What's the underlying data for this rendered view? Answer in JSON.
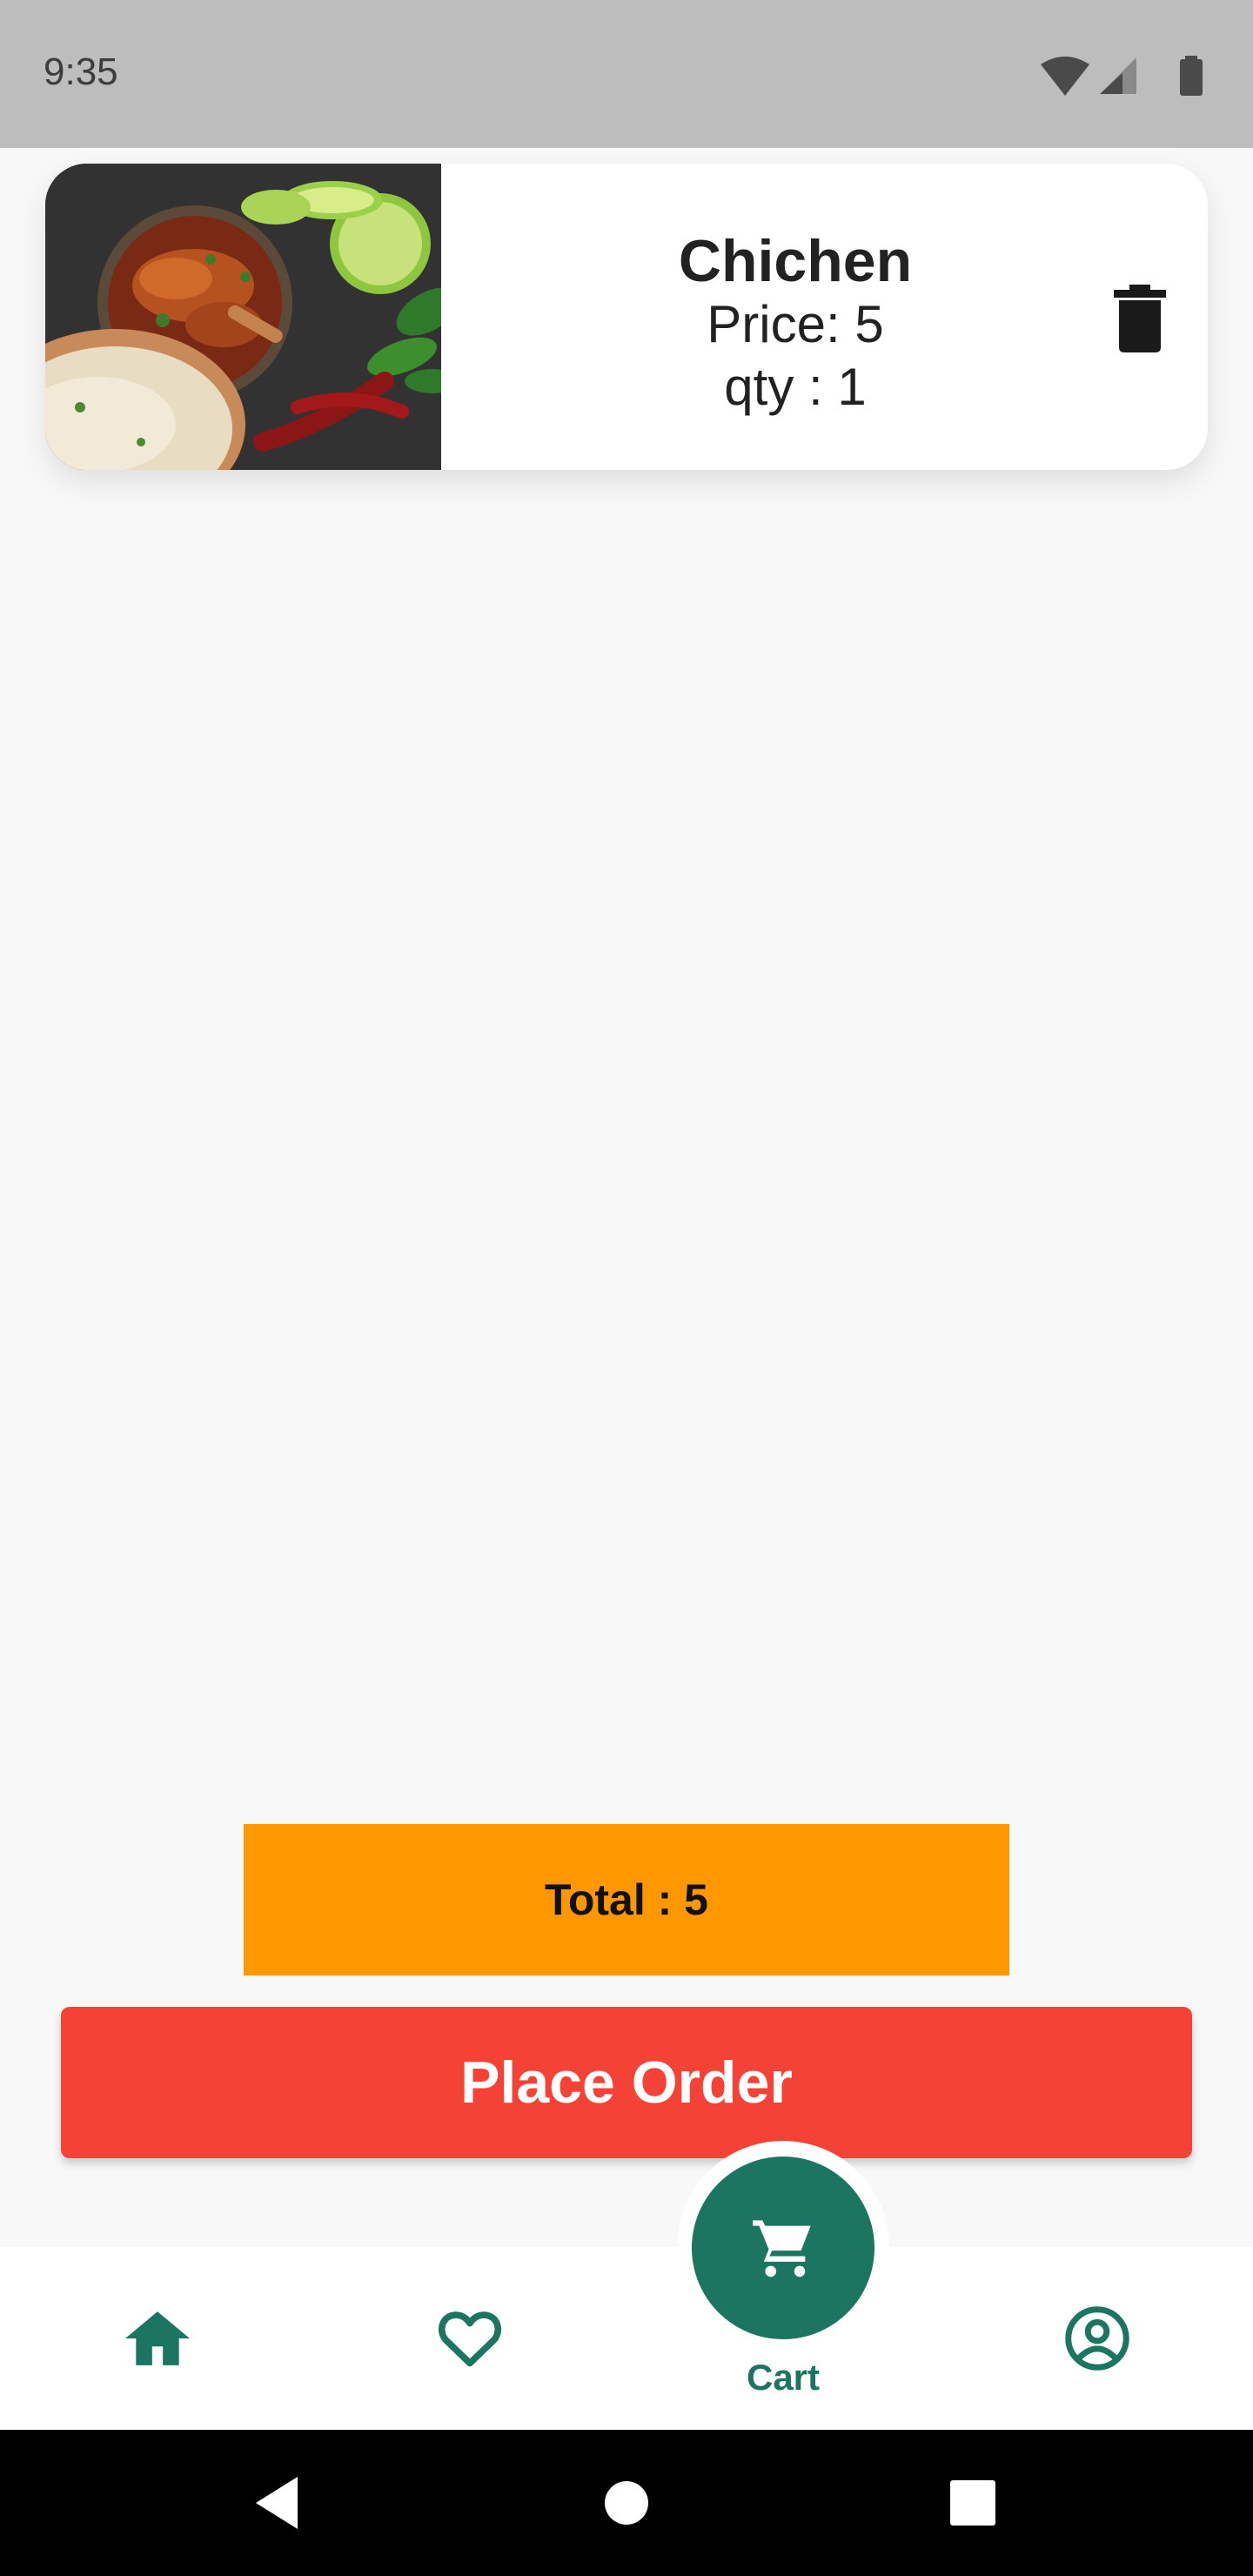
{
  "status_bar": {
    "time": "9:35",
    "icons": [
      "wifi-icon",
      "signal-icon",
      "battery-icon"
    ]
  },
  "cart": {
    "items": [
      {
        "name": "Chichen",
        "price": "Price: 5",
        "qty": "qty : 1",
        "image": "food-photo-chicken",
        "delete_icon": "trash-icon"
      }
    ],
    "total": "Total : 5",
    "place_order_label": "Place Order"
  },
  "bottom_nav": {
    "items": [
      {
        "icon": "home-icon"
      },
      {
        "icon": "heart-icon"
      },
      {
        "icon": "cart-icon",
        "label": "Cart",
        "active": true
      },
      {
        "icon": "account-circle-icon"
      }
    ]
  },
  "system_nav": {
    "buttons": [
      "back-icon",
      "home-circle-icon",
      "recents-icon"
    ]
  },
  "colors": {
    "accent": "#1b7560",
    "total_bar": "#ff9800",
    "place_order": "#f44336",
    "background": "#f8f8f8",
    "status_bar": "#bdbdbd"
  }
}
